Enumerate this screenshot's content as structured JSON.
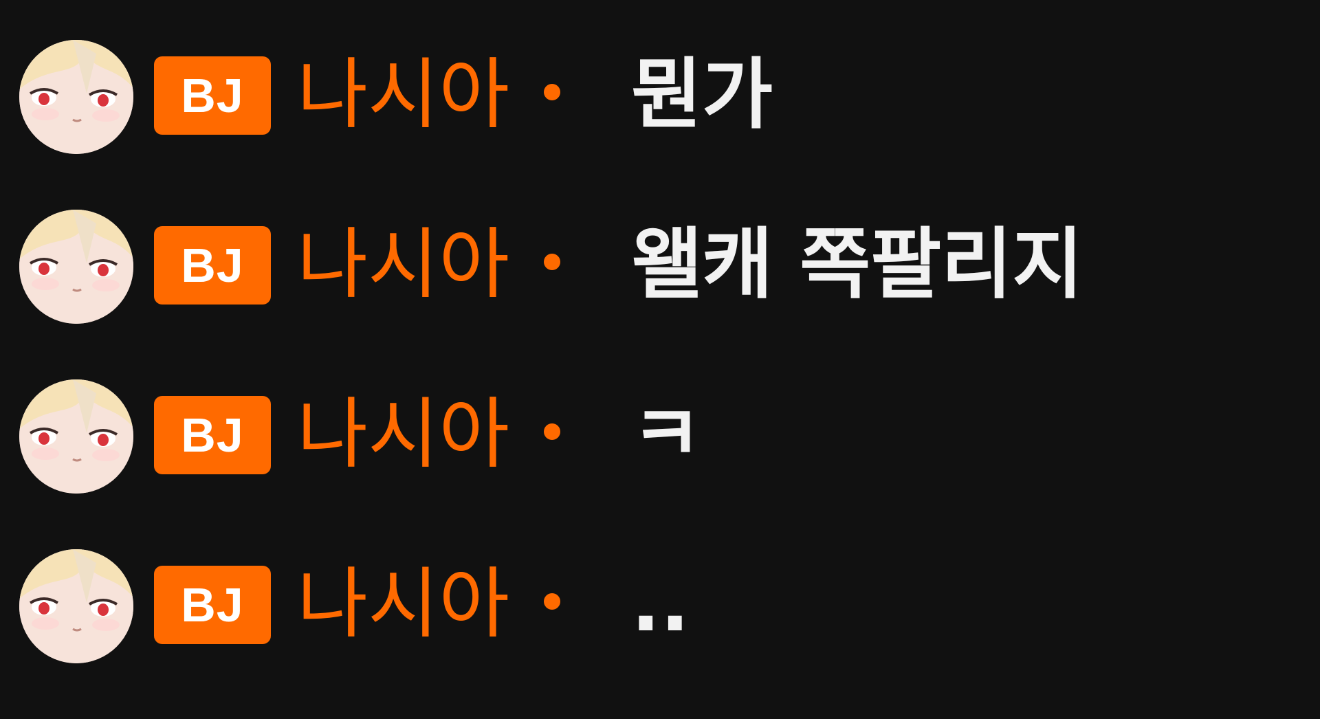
{
  "chat": {
    "messages": [
      {
        "badge": "BJ",
        "username": "나시아",
        "text": "뭔가"
      },
      {
        "badge": "BJ",
        "username": "나시아",
        "text": "왤캐 쪽팔리지"
      },
      {
        "badge": "BJ",
        "username": "나시아",
        "text": "ㅋ"
      },
      {
        "badge": "BJ",
        "username": "나시아",
        "text": ".."
      }
    ]
  },
  "colors": {
    "background": "#111111",
    "accent": "#ff6a00",
    "message_text": "#f2f2f2"
  }
}
